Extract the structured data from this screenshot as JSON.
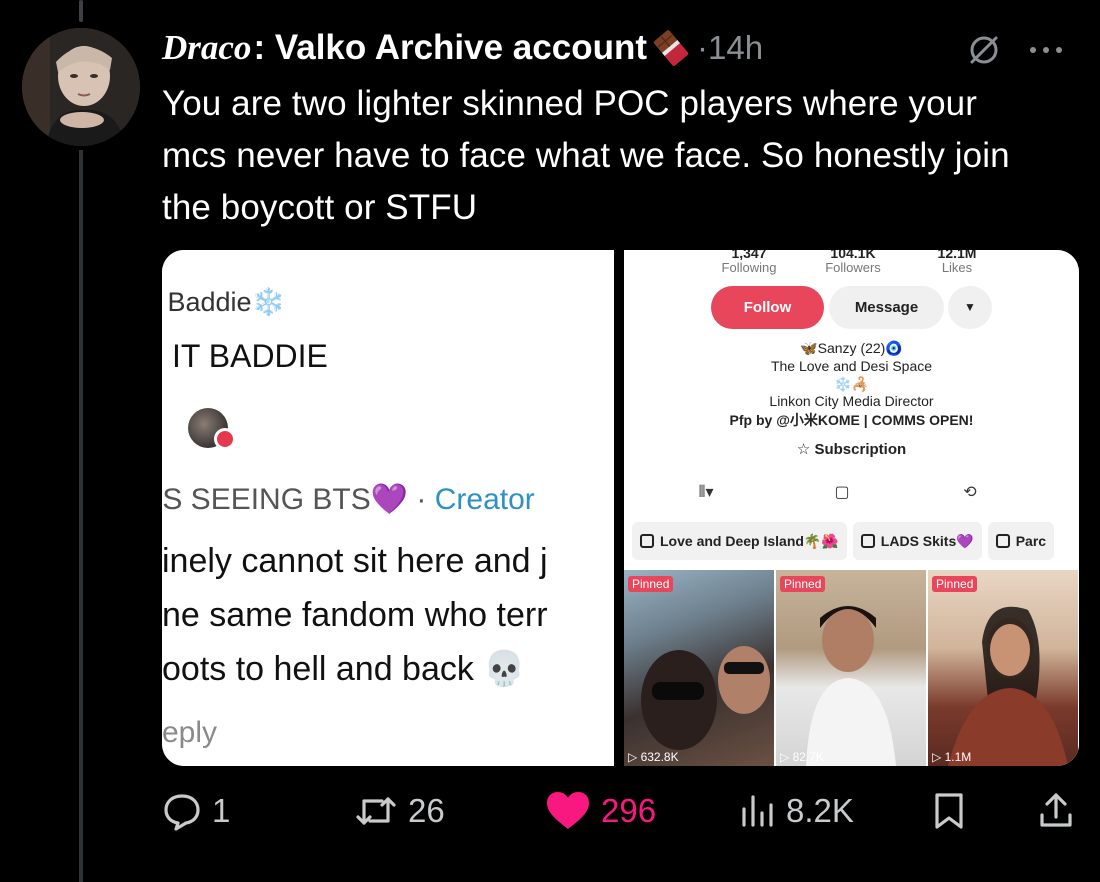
{
  "post": {
    "display_name_italic": "Draco",
    "display_name_rest": ": Valko Archive account",
    "timestamp": "14h",
    "separator": "·",
    "text": "You are two lighter skinned POC players where your mcs never have to face what we face. So honestly join the boycott or STFU"
  },
  "icons": {
    "badge": "chocolate-bar-icon",
    "mute": "mute-icon",
    "more": "more-icon",
    "reply": "reply-icon",
    "repost": "repost-icon",
    "like": "heart-icon",
    "views": "views-icon",
    "bookmark": "bookmark-icon",
    "share": "share-icon"
  },
  "media_left": {
    "name": "i Baddie❄️",
    "bio": "IT BADDIE",
    "title": "IS SEEING BTS💜",
    "title_sep": " · ",
    "creator": "Creator",
    "body_lines": [
      "inely cannot sit here and j",
      "ne same fandom who terr",
      "oots to hell and back 💀"
    ],
    "reply": "eply"
  },
  "media_right": {
    "stats": [
      {
        "num": "1,347",
        "label": "Following"
      },
      {
        "num": "104.1K",
        "label": "Followers"
      },
      {
        "num": "12.1M",
        "label": "Likes"
      }
    ],
    "follow_label": "Follow",
    "message_label": "Message",
    "dropdown_label": "▼",
    "bio_lines": [
      "🦋Sanzy (22)🧿",
      "The Love and Desi Space",
      "❄️🦂",
      "Linkon City Media Director",
      "Pfp by @小米KOME | COMMS OPEN!"
    ],
    "subscription": "Subscription",
    "chips": [
      "Love and Deep Island🌴🌺",
      "LADS Skits💜",
      "Parc"
    ],
    "thumbs": [
      {
        "pinned": "Pinned",
        "views": "632.8K"
      },
      {
        "pinned": "Pinned",
        "views": "82.7K"
      },
      {
        "pinned": "Pinned",
        "views": "1.1M"
      }
    ]
  },
  "actions": {
    "replies": "1",
    "reposts": "26",
    "likes": "296",
    "views": "8.2K"
  },
  "colors": {
    "background": "#000000",
    "text": "#ffffff",
    "muted": "#8b8f94",
    "like": "#f91880",
    "follow_button": "#e8465a",
    "creator_link": "#2f90c4"
  }
}
